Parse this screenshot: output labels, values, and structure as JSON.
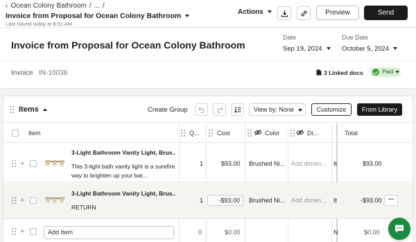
{
  "header": {
    "breadcrumb": [
      "Ocean Colony Bathroom",
      "...",
      "/"
    ],
    "doc_title": "Invoice from Proposal for Ocean Colony Bathroom",
    "last_saved": "Last Saved today at 8:51 AM",
    "actions_label": "Actions",
    "preview_label": "Preview",
    "send_label": "Send",
    "icons": [
      "download-icon",
      "link-icon"
    ]
  },
  "invoice": {
    "title": "Invoice from Proposal for Ocean Colony Bathroom",
    "date_label": "Date",
    "date_value": "Sep 19, 2024",
    "due_label": "Due Date",
    "due_value": "October 5, 2024",
    "type_label": "Invoice",
    "number": "IN-10038",
    "linked_docs": "3 Linked docs",
    "status": "Paid",
    "status_color": "#3f9d3f"
  },
  "items_bar": {
    "title": "Items",
    "create_group": "Create Group",
    "view_by": "View by: None",
    "customize": "Customize",
    "from_library": "From Library"
  },
  "table": {
    "columns": [
      "Item",
      "Q...",
      "Cost",
      "Color",
      "Di...",
      "Total"
    ],
    "rows": [
      {
        "name": "3-Light Bathroom Vanity Light, Brus...",
        "description": "This 3-light bath vanity light is a surefire way to brighten up your bat...",
        "qty": "1",
        "cost": "$93.00",
        "color": "Brushed Ni...",
        "dimensions": "Add dimen...",
        "extra": "It",
        "total": "$93.00"
      },
      {
        "name": "3-Light Bathroom Vanity Light, Brus...",
        "description": "RETURN",
        "qty": "1",
        "cost": "-$93.00",
        "color": "Brushed Ni...",
        "dimensions": "Add dimen...",
        "extra": "It",
        "total": "-$93.00",
        "menu": "..."
      }
    ],
    "add_row": {
      "placeholder": "Add Item",
      "qty": "0",
      "cost": "$0.00",
      "extra": "N",
      "total": "$0.00"
    }
  },
  "colors": {
    "primary_button": "#1b1b1b",
    "paid_badge_bg": "#dcefd8",
    "chat_button": "#1a8a3c"
  }
}
